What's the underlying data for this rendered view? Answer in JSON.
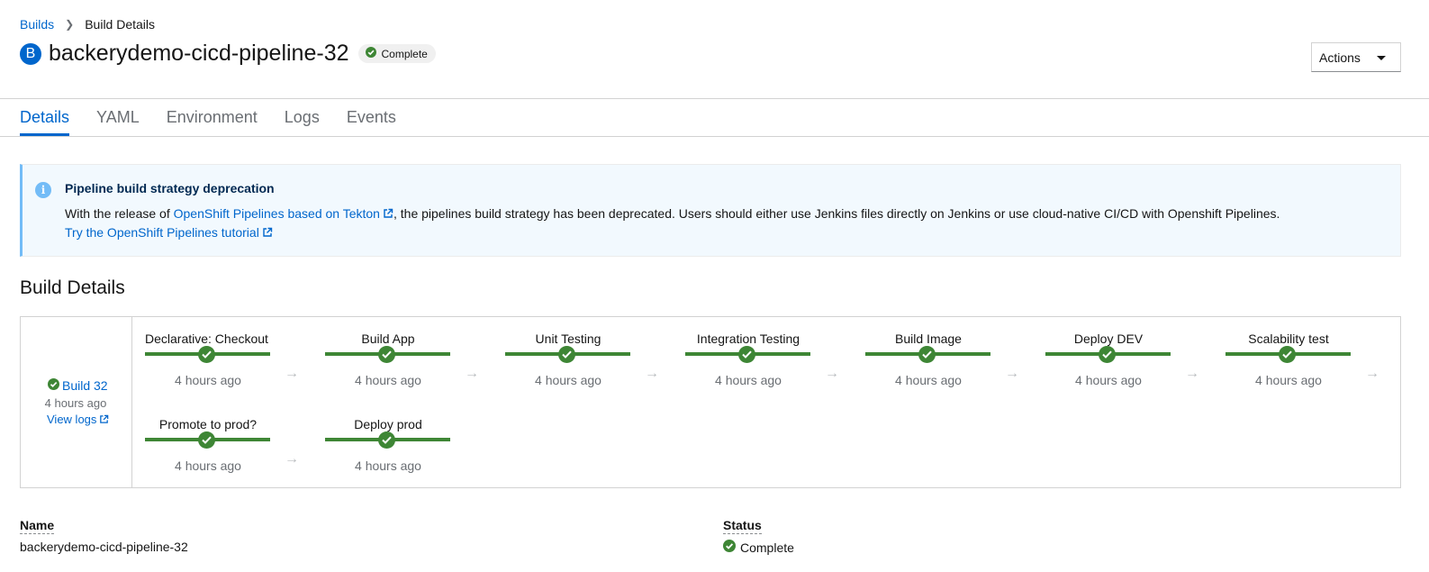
{
  "breadcrumb": {
    "parent": "Builds",
    "current": "Build Details"
  },
  "header": {
    "resource_badge": "B",
    "title": "backerydemo-cicd-pipeline-32",
    "status": "Complete",
    "actions_label": "Actions"
  },
  "tabs": [
    {
      "label": "Details",
      "active": true
    },
    {
      "label": "YAML"
    },
    {
      "label": "Environment"
    },
    {
      "label": "Logs"
    },
    {
      "label": "Events"
    }
  ],
  "alert": {
    "title": "Pipeline build strategy deprecation",
    "text_before": "With the release of ",
    "link_text": "OpenShift Pipelines based on Tekton",
    "text_after": ", the pipelines build strategy has been deprecated. Users should either use Jenkins files directly on Jenkins or use cloud-native CI/CD with Openshift Pipelines.",
    "tutorial_link": "Try the OpenShift Pipelines tutorial"
  },
  "section_title": "Build Details",
  "pipeline": {
    "build_label": "Build 32",
    "build_time": "4 hours ago",
    "view_logs": "View logs",
    "stages": [
      {
        "name": "Declarative: Checkout ...",
        "time": "4 hours ago",
        "status": "complete"
      },
      {
        "name": "Build App",
        "time": "4 hours ago",
        "status": "complete"
      },
      {
        "name": "Unit Testing",
        "time": "4 hours ago",
        "status": "complete"
      },
      {
        "name": "Integration Testing",
        "time": "4 hours ago",
        "status": "complete"
      },
      {
        "name": "Build Image",
        "time": "4 hours ago",
        "status": "complete"
      },
      {
        "name": "Deploy DEV",
        "time": "4 hours ago",
        "status": "complete"
      },
      {
        "name": "Scalability test",
        "time": "4 hours ago",
        "status": "complete"
      },
      {
        "name": "Promote to prod?",
        "time": "4 hours ago",
        "status": "complete"
      },
      {
        "name": "Deploy prod",
        "time": "4 hours ago",
        "status": "complete"
      }
    ]
  },
  "details": {
    "name_label": "Name",
    "name_value": "backerydemo-cicd-pipeline-32",
    "status_label": "Status",
    "status_value": "Complete"
  },
  "colors": {
    "link": "#0066cc",
    "success": "#3e8635",
    "info": "#73bcf7"
  }
}
